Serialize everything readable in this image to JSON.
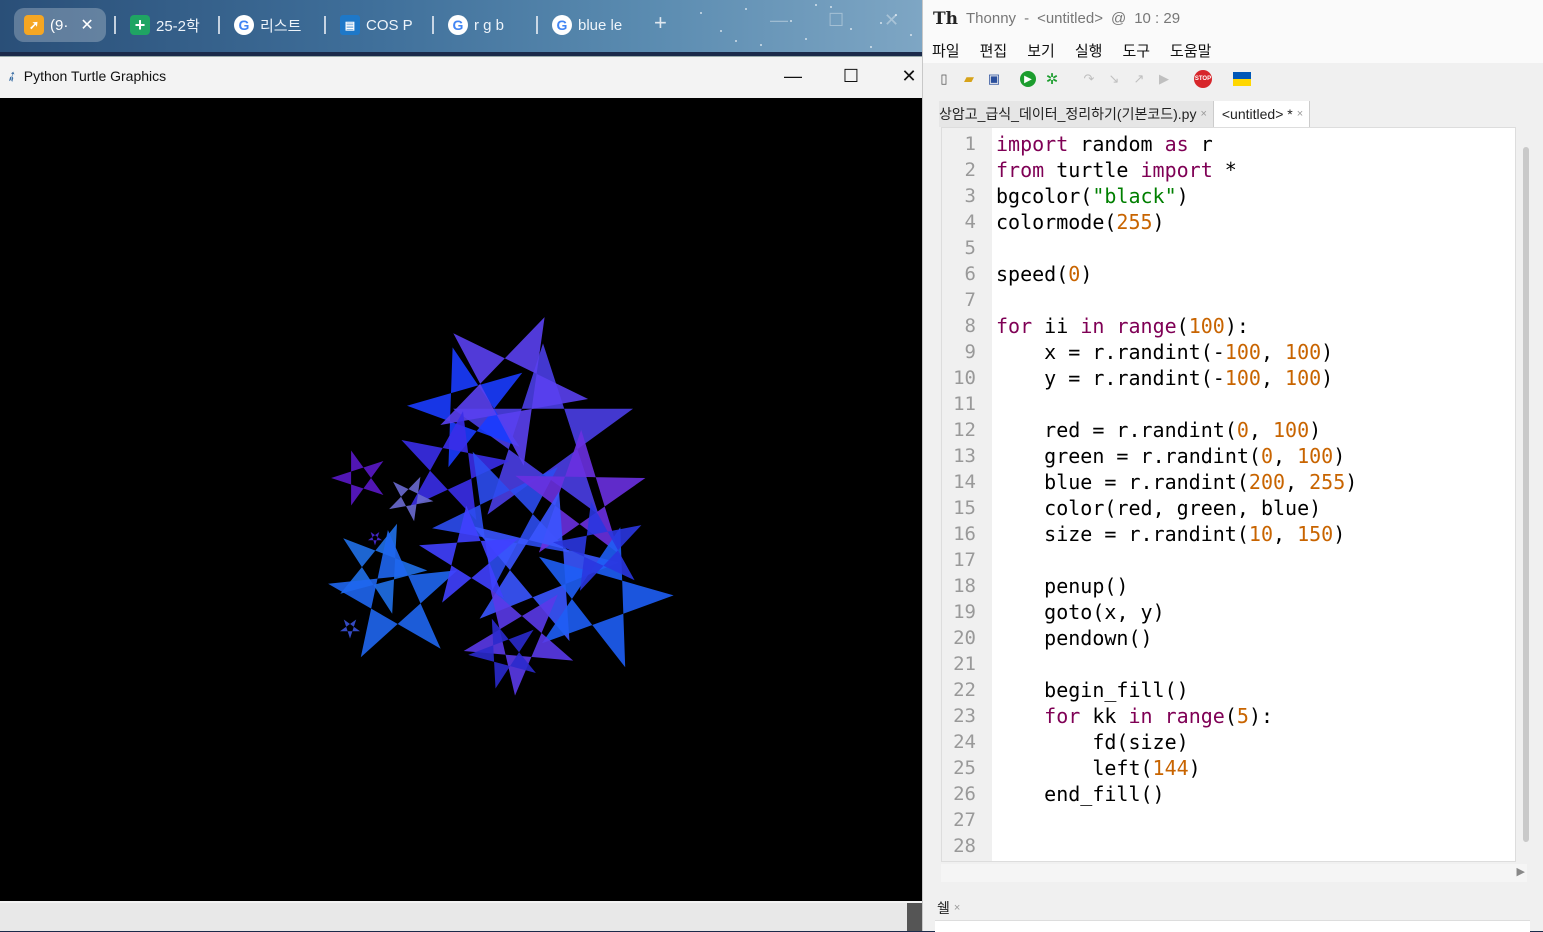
{
  "browser": {
    "tabs": [
      {
        "label": "(9·",
        "icon": "app-icon",
        "active": true,
        "close": "✕"
      },
      {
        "label": "25-2학",
        "icon": "sheets-icon"
      },
      {
        "label": "리스트",
        "icon": "google-icon"
      },
      {
        "label": "COS P",
        "icon": "site-icon"
      },
      {
        "label": "r g b",
        "icon": "google-icon"
      },
      {
        "label": "blue le",
        "icon": "google-icon"
      }
    ],
    "new_tab": "+"
  },
  "turtle_window": {
    "title": "Python Turtle Graphics",
    "controls": {
      "minimize": "—",
      "maximize": "☐",
      "close": "✕"
    },
    "canvas_bg": "#000000"
  },
  "thonny": {
    "title": {
      "app": "Thonny",
      "separator": "-",
      "file": "<untitled>",
      "at": "@",
      "position": "10 : 29"
    },
    "menu": [
      "파일",
      "편집",
      "보기",
      "실행",
      "도구",
      "도움말"
    ],
    "toolbar": [
      "new-file-icon",
      "open-folder-icon",
      "save-icon",
      "run-icon",
      "debug-icon",
      "step-over-icon",
      "step-into-icon",
      "step-out-icon",
      "resume-icon",
      "stop-icon",
      "ukraine-flag-icon"
    ],
    "editor_tabs": [
      {
        "label": "상암고_급식_데이터_정리하기(기본코드).py",
        "close": "×"
      },
      {
        "label": "<untitled> *",
        "close": "×",
        "active": true
      }
    ],
    "line_numbers": [
      "1",
      "2",
      "3",
      "4",
      "5",
      "6",
      "7",
      "8",
      "9",
      "10",
      "11",
      "12",
      "13",
      "14",
      "15",
      "16",
      "17",
      "18",
      "19",
      "20",
      "21",
      "22",
      "23",
      "24",
      "25",
      "26",
      "27",
      "28"
    ],
    "code_lines": [
      "import random as r",
      "from turtle import *",
      "bgcolor(\"black\")",
      "colormode(255)",
      "",
      "speed(0)",
      "",
      "for ii in range(100):",
      "    x = r.randint(-100, 100)",
      "    y = r.randint(-100, 100)",
      "",
      "    red = r.randint(0, 100)",
      "    green = r.randint(0, 100)",
      "    blue = r.randint(200, 255)",
      "    color(red, green, blue)",
      "    size = r.randint(10, 150)",
      "",
      "    penup()",
      "    goto(x, y)",
      "    pendown()",
      "",
      "    begin_fill()",
      "    for kk in range(5):",
      "        fd(size)",
      "        left(144)",
      "    end_fill()",
      "",
      ""
    ],
    "shell_tab": {
      "label": "쉘",
      "close": "×"
    }
  },
  "colors": {
    "keyword": "#7f0055",
    "number": "#c86400",
    "string": "#007f00"
  }
}
